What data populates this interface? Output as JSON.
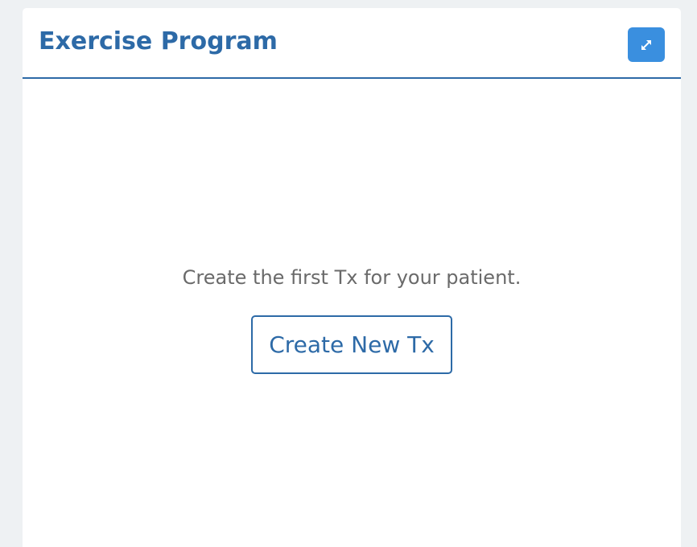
{
  "panel": {
    "title": "Exercise Program",
    "expand_icon": "expand-arrows-icon"
  },
  "empty_state": {
    "message": "Create the first Tx for your patient.",
    "button_label": "Create New Tx"
  },
  "colors": {
    "page_background": "#eef1f3",
    "panel_background": "#ffffff",
    "accent": "#2d6aa7",
    "button_blue": "#3a8fdf",
    "message_text": "#6a6a6a"
  }
}
